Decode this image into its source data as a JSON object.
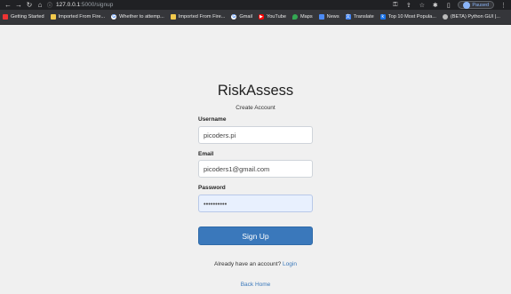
{
  "browser": {
    "url_host": "127.0.0.1",
    "url_path": ":5000/signup",
    "profile_status": "Paused"
  },
  "bookmarks": [
    {
      "label": "Getting Started",
      "icon": "red-square-icon"
    },
    {
      "label": "Imported From Fire...",
      "icon": "folder-icon"
    },
    {
      "label": "Whether to attemp...",
      "icon": "google-icon"
    },
    {
      "label": "Imported From Fire...",
      "icon": "folder-icon"
    },
    {
      "label": "Gmail",
      "icon": "google-icon"
    },
    {
      "label": "YouTube",
      "icon": "youtube-icon"
    },
    {
      "label": "Maps",
      "icon": "maps-icon"
    },
    {
      "label": "News",
      "icon": "news-icon"
    },
    {
      "label": "Translate",
      "icon": "translate-icon"
    },
    {
      "label": "Top 10 Most Popula...",
      "icon": "bookmark-icon"
    },
    {
      "label": "(BETA) Python GUI |...",
      "icon": "globe-icon"
    }
  ],
  "page": {
    "title": "RiskAssess",
    "subtitle": "Create Account",
    "username_label": "Username",
    "username_value": "picoders.pi",
    "email_label": "Email",
    "email_value": "picoders1@gmail.com",
    "password_label": "Password",
    "password_value": "••••••••••",
    "signup_button": "Sign Up",
    "login_prompt": "Already have an account?",
    "login_link": "Login",
    "back_home": "Back Home"
  },
  "colors": {
    "primary_button": "#3a78bb",
    "background": "#f0f0f0"
  }
}
